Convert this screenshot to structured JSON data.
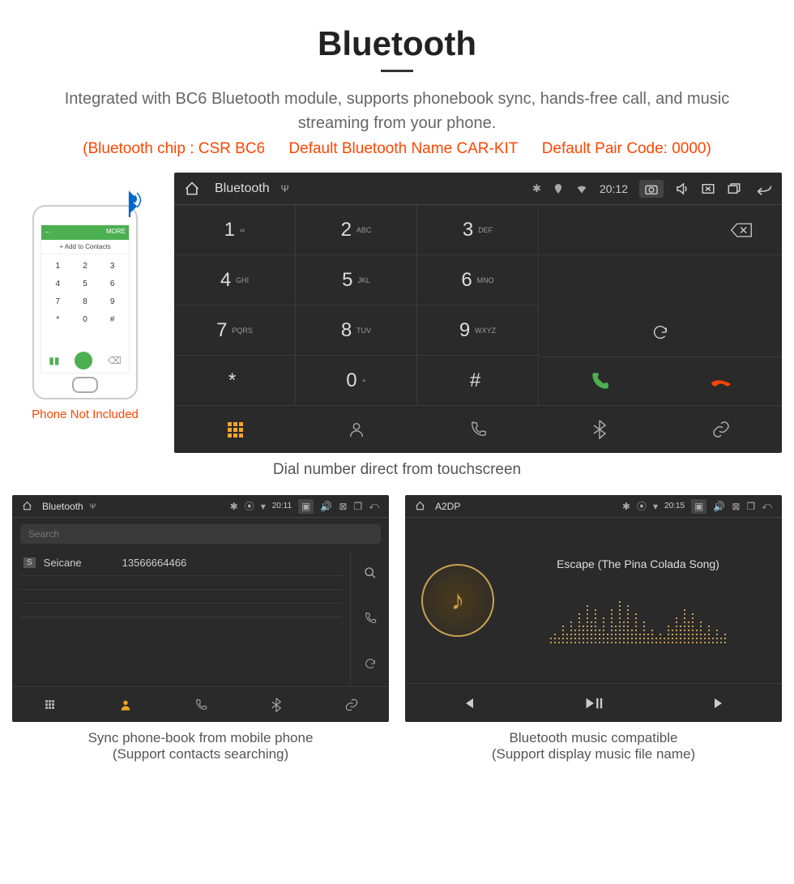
{
  "header": {
    "title": "Bluetooth",
    "description": "Integrated with BC6 Bluetooth module, supports phonebook sync, hands-free call, and music streaming from your phone.",
    "spec_chip": "(Bluetooth chip : CSR BC6",
    "spec_name": "Default Bluetooth Name CAR-KIT",
    "spec_code": "Default Pair Code: 0000)"
  },
  "phone": {
    "header_left": "←",
    "header_right": "MORE",
    "add_contacts": "+  Add to Contacts",
    "note": "Phone Not Included"
  },
  "main_device": {
    "title": "Bluetooth",
    "time": "20:12",
    "keys": [
      {
        "num": "1",
        "sub": "∞"
      },
      {
        "num": "2",
        "sub": "ABC"
      },
      {
        "num": "3",
        "sub": "DEF"
      },
      {
        "num": "4",
        "sub": "GHI"
      },
      {
        "num": "5",
        "sub": "JKL"
      },
      {
        "num": "6",
        "sub": "MNO"
      },
      {
        "num": "7",
        "sub": "PQRS"
      },
      {
        "num": "8",
        "sub": "TUV"
      },
      {
        "num": "9",
        "sub": "WXYZ"
      },
      {
        "num": "*",
        "sub": ""
      },
      {
        "num": "0",
        "sub": "+"
      },
      {
        "num": "#",
        "sub": ""
      }
    ],
    "caption": "Dial number direct from touchscreen"
  },
  "phonebook_device": {
    "title": "Bluetooth",
    "time": "20:11",
    "search_placeholder": "Search",
    "contact_badge": "S",
    "contact_name": "Seicane",
    "contact_number": "13566664466",
    "caption_line1": "Sync phone-book from mobile phone",
    "caption_line2": "(Support contacts searching)"
  },
  "music_device": {
    "title": "A2DP",
    "time": "20:15",
    "song": "Escape (The Pina Colada Song)",
    "caption_line1": "Bluetooth music compatible",
    "caption_line2": "(Support display music file name)"
  }
}
